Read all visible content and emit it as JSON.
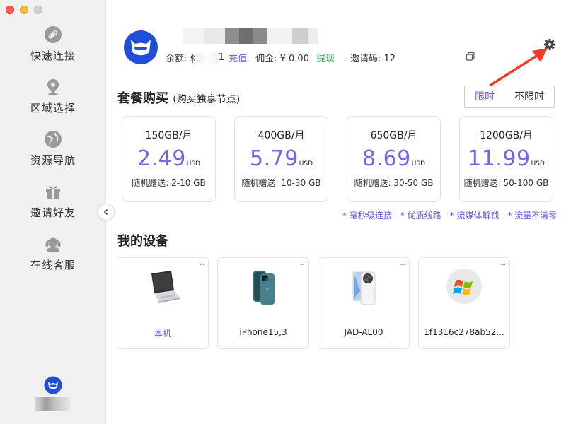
{
  "sidebar": {
    "items": [
      {
        "label": "快速连接",
        "icon": "link-icon"
      },
      {
        "label": "区域选择",
        "icon": "location-pin-icon"
      },
      {
        "label": "资源导航",
        "icon": "globe-icon"
      },
      {
        "label": "邀请好友",
        "icon": "gift-icon"
      },
      {
        "label": "在线客服",
        "icon": "headset-icon"
      }
    ]
  },
  "user": {
    "balance_label": "余额: $",
    "balance_tail": "1",
    "recharge_label": "充值",
    "commission_label": "佣金: ¥ 0.00",
    "withdraw_label": "提现",
    "invite_label": "邀请码: 12"
  },
  "plans_section": {
    "title": "套餐购买",
    "subtitle": "(购买独享节点)",
    "toggle": {
      "limited": "限时",
      "unlimited": "不限时",
      "selected": "limited"
    }
  },
  "plans": [
    {
      "name": "150GB/月",
      "price": "2.49",
      "currency": "USD",
      "bonus": "随机赠送: 2-10 GB"
    },
    {
      "name": "400GB/月",
      "price": "5.79",
      "currency": "USD",
      "bonus": "随机赠送: 10-30 GB"
    },
    {
      "name": "650GB/月",
      "price": "8.69",
      "currency": "USD",
      "bonus": "随机赠送: 30-50 GB"
    },
    {
      "name": "1200GB/月",
      "price": "11.99",
      "currency": "USD",
      "bonus": "随机赠送: 50-100 GB"
    }
  ],
  "features": [
    "* 毫秒级连接",
    "* 优质线路",
    "* 流媒体解锁",
    "* 流量不清零"
  ],
  "devices_section": {
    "title": "我的设备"
  },
  "devices": [
    {
      "name": "本机",
      "icon": "laptop-icon",
      "current": true
    },
    {
      "name": "iPhone15,3",
      "icon": "iphone-icon",
      "current": false
    },
    {
      "name": "JAD-AL00",
      "icon": "android-phone-icon",
      "current": false
    },
    {
      "name": "1f1316c278ab52...",
      "icon": "windows-icon",
      "current": false
    }
  ],
  "more_label": "...",
  "colors": {
    "accent": "#7b61e6",
    "green": "#2aa94e",
    "brand_blue": "#1f4fd8",
    "arrow_red": "#f03a24"
  }
}
